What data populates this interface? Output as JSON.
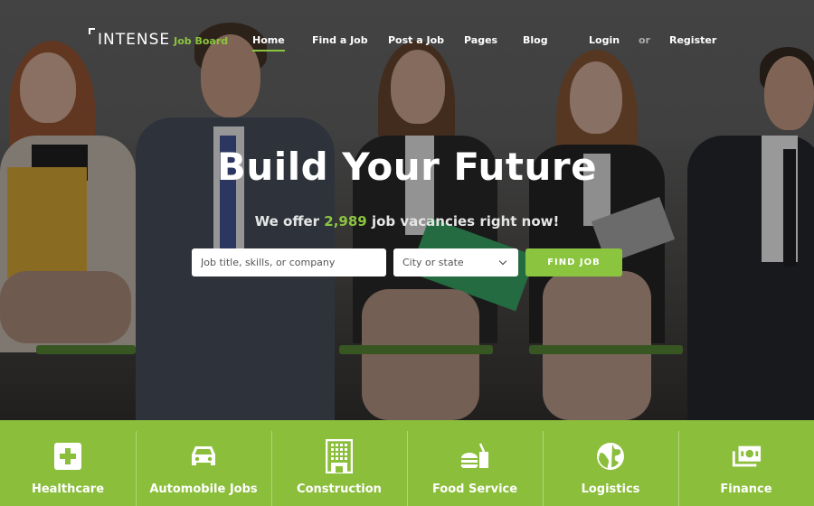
{
  "brand": {
    "name": "INTENSE",
    "tagline": "Job Board",
    "accent_color": "#8bc53f"
  },
  "nav": {
    "items": [
      {
        "label": "Home",
        "active": true
      },
      {
        "label": "Find a Job",
        "active": false
      },
      {
        "label": "Post a Job",
        "active": false
      },
      {
        "label": "Pages",
        "active": false
      },
      {
        "label": "Blog",
        "active": false
      }
    ],
    "login_label": "Login",
    "or_label": "or",
    "register_label": "Register"
  },
  "hero": {
    "headline": "Build Your Future",
    "subline_prefix": "We offer ",
    "job_count": "2,989",
    "subline_suffix": " job vacancies right now!"
  },
  "search": {
    "keyword_placeholder": "Job title, skills, or company",
    "keyword_value": "",
    "location_selected": "City or state",
    "button_label": "FIND JOB"
  },
  "categories": [
    {
      "label": "Healthcare",
      "icon": "medical-cross-icon"
    },
    {
      "label": "Automobile Jobs",
      "icon": "car-icon"
    },
    {
      "label": "Construction",
      "icon": "building-icon"
    },
    {
      "label": "Food Service",
      "icon": "burger-drink-icon"
    },
    {
      "label": "Logistics",
      "icon": "globe-icon"
    },
    {
      "label": "Finance",
      "icon": "money-icon"
    }
  ]
}
